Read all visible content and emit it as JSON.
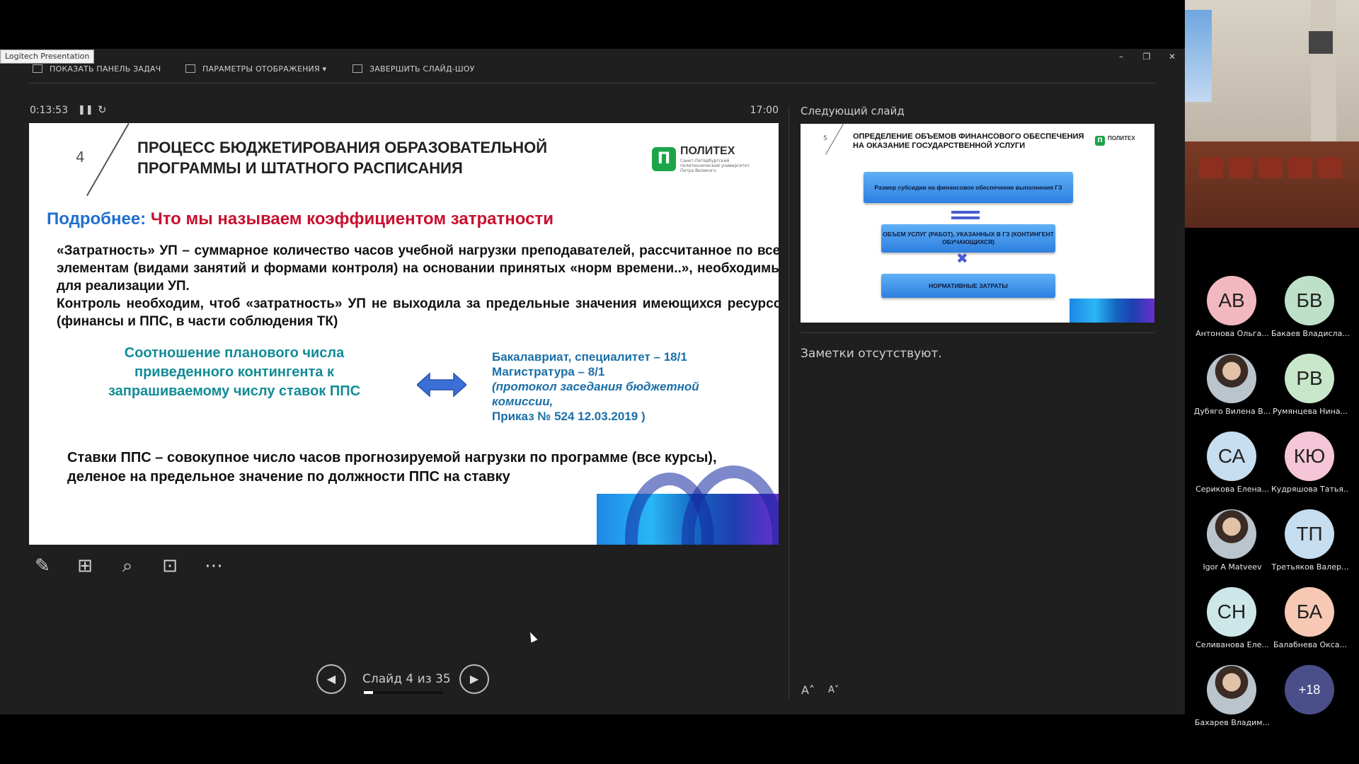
{
  "app": {
    "label": "Logitech Presentation",
    "toolbar": {
      "show_taskbar": "ПОКАЗАТЬ ПАНЕЛЬ ЗАДАЧ",
      "display_settings": "ПАРАМЕТРЫ ОТОБРАЖЕНИЯ ▾",
      "end_show": "ЗАВЕРШИТЬ СЛАЙД-ШОУ"
    },
    "timer": "0:13:53",
    "clock": "17:00"
  },
  "slide": {
    "number": "4",
    "title_line1": "ПРОЦЕСС БЮДЖЕТИРОВАНИЯ ОБРАЗОВАТЕЛЬНОЙ",
    "title_line2": "ПРОГРАММЫ И ШТАТНОГО РАСПИСАНИЯ",
    "logo_name": "ПОЛИТЕХ",
    "logo_sub": "Санкт-Петербургский политехнический университет Петра Великого",
    "subtitle_blue": "Подробнее:",
    "subtitle_red": "Что мы называем коэффициентом затратности",
    "para1": "«Затратность» УП – суммарное количество часов учебной нагрузки преподавателей, рассчитанное по всем элементам (видами занятий и формами контроля) на основании принятых «норм времени..», необходимых для реализации УП.",
    "para1b": "Контроль необходим, чтоб «затратность» УП не выходила за предельные значения имеющихся ресурсов (финансы и ППС, в части соблюдения ТК)",
    "ratio_left": "Соотношение планового числа приведенного контингента к запрашиваемому числу ставок ППС",
    "ratio_right_1": "Бакалавриат, специалитет – 18/1",
    "ratio_right_2": "Магистратура – 8/1",
    "ratio_right_3": "(протокол заседания бюджетной комиссии,",
    "ratio_right_4": "Приказ № 524 12.03.2019 )",
    "para2": "Ставки ППС – совокупное число часов прогнозируемой нагрузки по программе (все курсы), деленое на предельное значение по должности ППС на ставку"
  },
  "navigation": {
    "counter": "Слайд 4 из 35",
    "current": 4,
    "total": 35
  },
  "next_slide": {
    "label": "Следующий слайд",
    "number": "5",
    "title": "ОПРЕДЕЛЕНИЕ ОБЪЕМОВ ФИНАНСОВОГО ОБЕСПЕЧЕНИЯ НА ОКАЗАНИЕ ГОСУДАРСТВЕННОЙ УСЛУГИ",
    "logo_name": "ПОЛИТЕХ",
    "box1": "Размер субсидии на финансовое обеспечение выполнения ГЗ",
    "box2": "ОБЪЕМ УСЛУГ (РАБОТ), УКАЗАННЫХ В ГЗ (КОНТИНГЕНТ ОБУЧАЮЩИХСЯ)",
    "box3": "НОРМАТИВНЫЕ ЗАТРАТЫ"
  },
  "notes": "Заметки отсутствуют.",
  "participants": [
    {
      "initials": "АВ",
      "name": "Антонова Ольга...",
      "color": "#f2b8c0"
    },
    {
      "initials": "БВ",
      "name": "Бакаев Владисла...",
      "color": "#bfe0c8"
    },
    {
      "initials": "",
      "name": "Дубяго Вилена В...",
      "color": "#dddddd"
    },
    {
      "initials": "РВ",
      "name": "Румянцева Нина...",
      "color": "#c8e6c9"
    },
    {
      "initials": "СА",
      "name": "Серикова Елена...",
      "color": "#c7def0"
    },
    {
      "initials": "КЮ",
      "name": "Кудряшова Татья...",
      "color": "#f4c6d8"
    },
    {
      "initials": "",
      "name": "Igor A Matveev",
      "color": "#cccccc"
    },
    {
      "initials": "ТП",
      "name": "Третьяков Валер...",
      "color": "#c7def0"
    },
    {
      "initials": "СН",
      "name": "Селиванова Еле...",
      "color": "#cde7e9"
    },
    {
      "initials": "БА",
      "name": "Балабнева Окса...",
      "color": "#f7c9b5"
    },
    {
      "initials": "",
      "name": "Бахарев Владим...",
      "color": "#cccccc"
    },
    {
      "initials": "+18",
      "name": "",
      "color": "#4a4f8a"
    }
  ]
}
